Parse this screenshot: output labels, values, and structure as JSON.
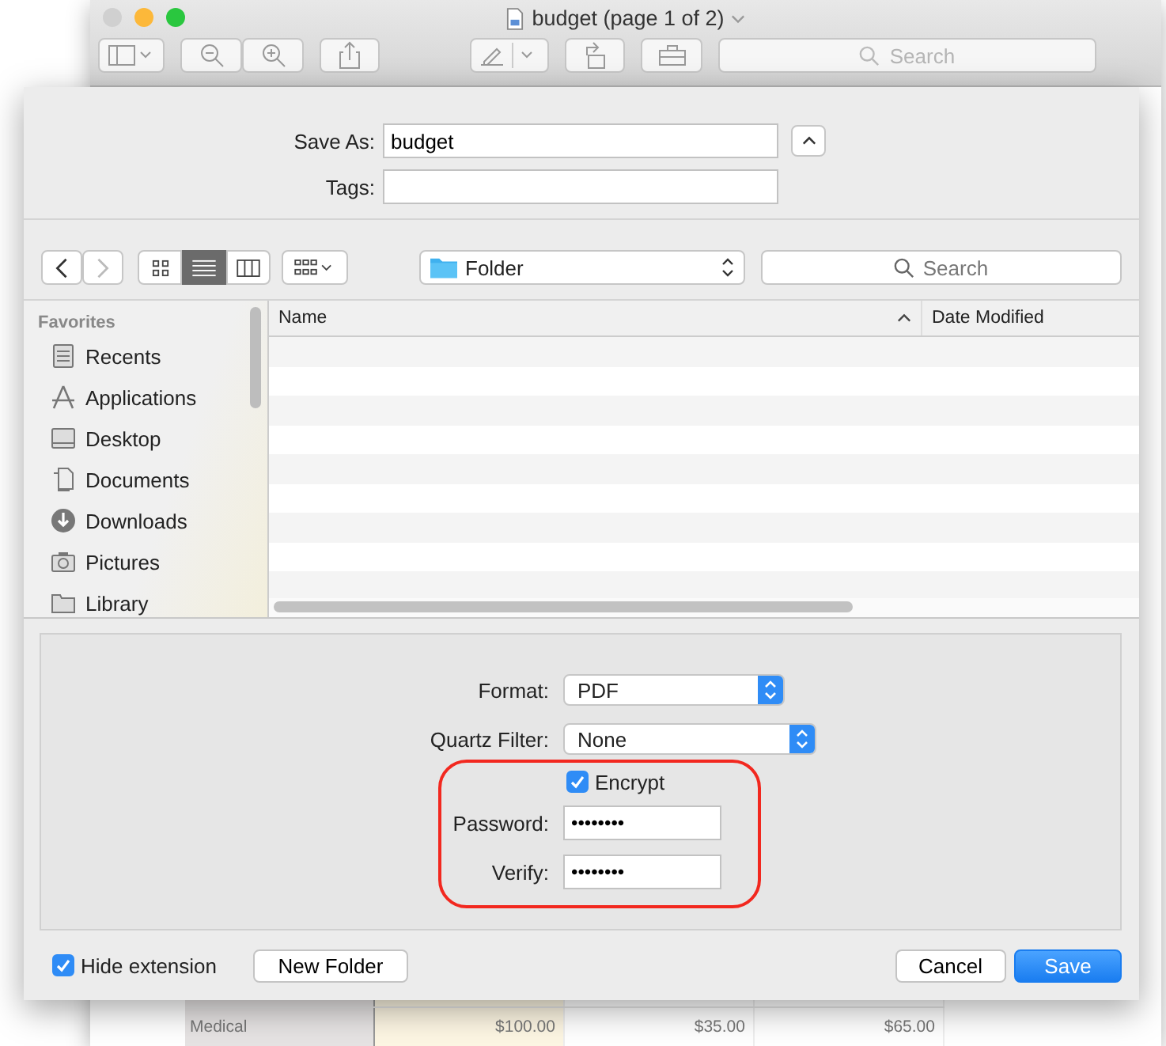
{
  "viewer": {
    "title": "budget (page 1 of 2)",
    "search": {
      "placeholder": "Search"
    }
  },
  "spreadsheet": {
    "rows": [
      {
        "label": "Medical",
        "cells": [
          "$100.00",
          "$35.00",
          "$65.00"
        ]
      }
    ]
  },
  "dialog": {
    "save_as": {
      "label": "Save As:",
      "value": "budget"
    },
    "tags": {
      "label": "Tags:"
    },
    "expanded": true,
    "view_modes": [
      {
        "kind": "icons",
        "selected": false
      },
      {
        "kind": "list",
        "selected": true
      },
      {
        "kind": "columns",
        "selected": false
      }
    ],
    "location": "Folder",
    "search": {
      "placeholder": "Search"
    },
    "sidebar": {
      "heading": "Favorites",
      "items": [
        {
          "kind": "recents",
          "label": "Recents"
        },
        {
          "kind": "applications",
          "label": "Applications"
        },
        {
          "kind": "desktop",
          "label": "Desktop"
        },
        {
          "kind": "documents",
          "label": "Documents"
        },
        {
          "kind": "downloads",
          "label": "Downloads"
        },
        {
          "kind": "pictures",
          "label": "Pictures"
        },
        {
          "kind": "folder",
          "label": "Library"
        }
      ]
    },
    "columns": [
      "Name",
      "Date Modified"
    ],
    "options": {
      "format": {
        "label": "Format:",
        "value": "PDF"
      },
      "quartz_filter": {
        "label": "Quartz Filter:",
        "value": "None"
      },
      "encrypt": {
        "label": "Encrypt",
        "checked": true
      },
      "password": {
        "label": "Password:",
        "value": "••••••••"
      },
      "verify": {
        "label": "Verify:",
        "value": "••••••••"
      }
    },
    "hide_extension": {
      "label": "Hide extension",
      "checked": true
    },
    "buttons": {
      "new_folder": "New Folder",
      "cancel": "Cancel",
      "save": "Save"
    }
  }
}
